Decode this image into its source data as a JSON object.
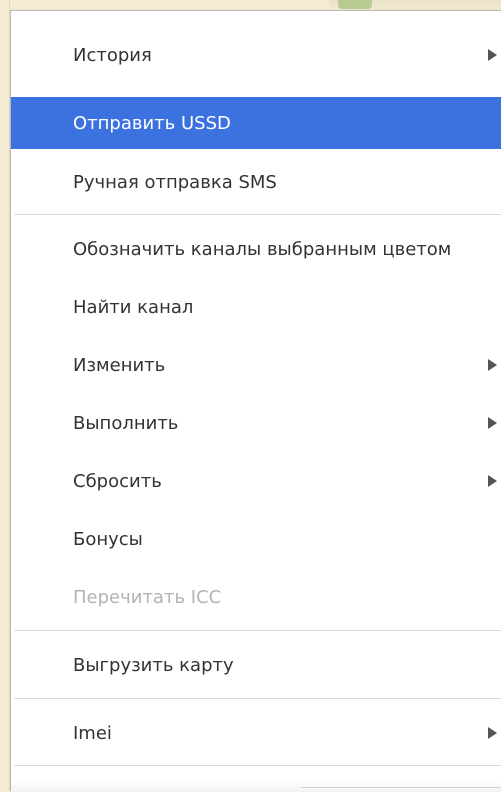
{
  "menu": {
    "items": [
      {
        "label": "История",
        "submenu": true
      },
      {
        "label": "Отправить USSD",
        "highlighted": true
      },
      {
        "label": "Ручная отправка SMS"
      },
      {
        "label": "Обозначить каналы выбранным цветом"
      },
      {
        "label": "Найти канал"
      },
      {
        "label": "Изменить",
        "submenu": true
      },
      {
        "label": "Выполнить",
        "submenu": true
      },
      {
        "label": "Сбросить",
        "submenu": true
      },
      {
        "label": "Бонусы"
      },
      {
        "label": "Перечитать ICC",
        "disabled": true
      },
      {
        "label": "Выгрузить карту"
      },
      {
        "label": "Imei",
        "submenu": true
      }
    ]
  },
  "colors": {
    "highlight": "#3b72e0",
    "text": "#333333",
    "disabled_text": "#b3b3b3",
    "background": "#f3ecd2"
  },
  "icons": {
    "submenu": "triangle-right-icon"
  }
}
